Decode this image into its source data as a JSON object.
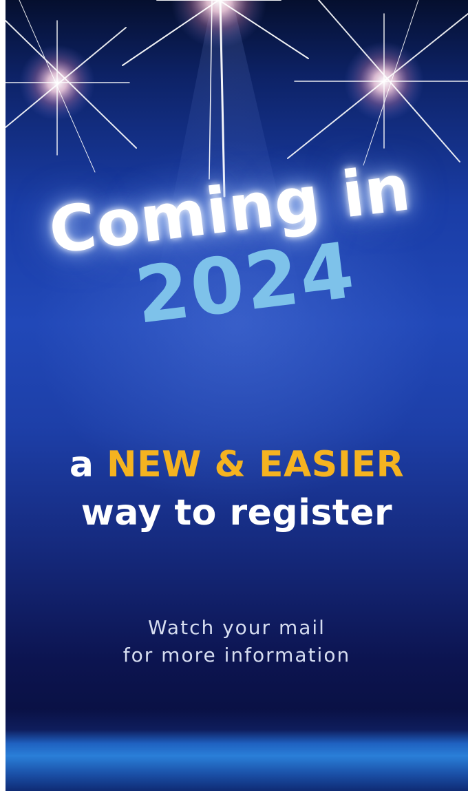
{
  "poster": {
    "headline": "Coming in",
    "year": "2024",
    "tagline_prefix": "a",
    "tagline_highlight": "NEW & EASIER",
    "tagline_line2": "way to register",
    "notice_line1": "Watch your mail",
    "notice_line2": "for more information"
  },
  "colors": {
    "background": "#1d3fa8",
    "year": "#7ec2ea",
    "highlight": "#f5b320",
    "text": "#ffffff"
  },
  "icons": [
    "spotlight-left-icon",
    "spotlight-center-icon",
    "spotlight-right-icon"
  ]
}
